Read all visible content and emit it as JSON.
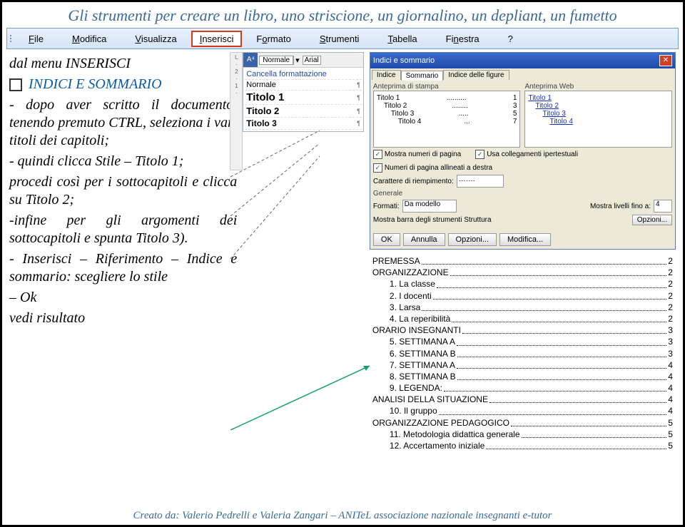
{
  "title": "Gli strumenti per creare un libro, uno striscione, un giornalino, un depliant, un fumetto",
  "footer": "Creato da: Valerio Pedrelli e Valeria Zangari – ANITeL associazione nazionale insegnanti e-tutor",
  "menu": {
    "file": "File",
    "modifica": "Modifica",
    "visualizza": "Visualizza",
    "inserisci": "Inserisci",
    "formato": "Formato",
    "strumenti": "Strumenti",
    "tabella": "Tabella",
    "finestra": "Finestra",
    "help": "?"
  },
  "left": {
    "l1": "dal menu INSERISCI",
    "l2": "INDICI E SOMMARIO",
    "l3": "- dopo aver scritto il documento, tenendo premuto CTRL, seleziona i vari titoli dei capitoli;",
    "l4": "- quindi clicca Stile – Titolo 1;",
    "l5": "procedi così per i sottocapitoli e clicca su Titolo 2;",
    "l6": "-infine per gli argomenti dei sottocapitoli e spunta Titolo 3).",
    "l7": "- Inserisci – Riferimento – Indice e sommario: scegliere lo stile",
    "l8": "– Ok",
    "l9": "vedi risultato"
  },
  "styles": {
    "normale": "Normale",
    "arial": "Arial",
    "cancel": "Cancella formattazione",
    "rows": [
      {
        "n": "Normale",
        "cls": ""
      },
      {
        "n": "Titolo 1",
        "cls": "h1"
      },
      {
        "n": "Titolo 2",
        "cls": "h2"
      },
      {
        "n": "Titolo 3",
        "cls": "h3"
      }
    ],
    "para": "¶"
  },
  "dlg": {
    "title": "Indici e sommario",
    "tabs": {
      "indice": "Indice",
      "sommario": "Sommario",
      "figure": "Indice delle figure"
    },
    "prev_stampa": "Anteprima di stampa",
    "prev_web": "Anteprima Web",
    "stampa_lines": [
      [
        "Titolo 1",
        "1"
      ],
      [
        "Titolo 2",
        "3"
      ],
      [
        "Titolo 3",
        "5"
      ],
      [
        "Titolo 4",
        "7"
      ]
    ],
    "web_lines": [
      "Titolo 1",
      "Titolo 2",
      "Titolo 3",
      "Titolo 4"
    ],
    "chk_numeri": "Mostra numeri di pagina",
    "chk_usacol": "Usa collegamenti ipertestuali",
    "chk_allineati": "Numeri di pagina allineati a destra",
    "carattere": "Carattere di riempimento:",
    "car_val": "…….",
    "generale": "Generale",
    "formati": "Formati:",
    "formati_val": "Da modello",
    "livelli": "Mostra livelli fino a:",
    "livelli_val": "4",
    "barra": "Mostra barra degli strumenti Struttura",
    "opzioni": "Opzioni...",
    "btns": {
      "ok": "OK",
      "annulla": "Annulla",
      "opzioni": "Opzioni...",
      "modifica": "Modifica..."
    }
  },
  "toc": [
    {
      "t": "PREMESSA",
      "p": "2",
      "l": 0,
      "n": ""
    },
    {
      "t": "ORGANIZZAZIONE",
      "p": "2",
      "l": 0,
      "n": ""
    },
    {
      "t": "La classe",
      "p": "2",
      "l": 1,
      "n": "1."
    },
    {
      "t": "I docenti",
      "p": "2",
      "l": 1,
      "n": "2."
    },
    {
      "t": "Larsa",
      "p": "2",
      "l": 1,
      "n": "3."
    },
    {
      "t": "La reperibilità",
      "p": "2",
      "l": 1,
      "n": "4."
    },
    {
      "t": "ORARIO INSEGNANTI",
      "p": "3",
      "l": 0,
      "n": ""
    },
    {
      "t": "SETTIMANA A",
      "p": "3",
      "l": 1,
      "n": "5."
    },
    {
      "t": "SETTIMANA B",
      "p": "3",
      "l": 1,
      "n": "6."
    },
    {
      "t": "SETTIMANA A",
      "p": "4",
      "l": 1,
      "n": "7."
    },
    {
      "t": "SETTIMANA B",
      "p": "4",
      "l": 1,
      "n": "8."
    },
    {
      "t": "LEGENDA:",
      "p": "4",
      "l": 1,
      "n": "9."
    },
    {
      "t": "ANALISI DELLA SITUAZIONE",
      "p": "4",
      "l": 0,
      "n": ""
    },
    {
      "t": "Il gruppo",
      "p": "4",
      "l": 1,
      "n": "10."
    },
    {
      "t": "ORGANIZZAZIONE PEDAGOGICO",
      "p": "5",
      "l": 0,
      "n": ""
    },
    {
      "t": "Metodologia didattica generale",
      "p": "5",
      "l": 1,
      "n": "11."
    },
    {
      "t": "Accertamento iniziale",
      "p": "5",
      "l": 1,
      "n": "12."
    }
  ]
}
